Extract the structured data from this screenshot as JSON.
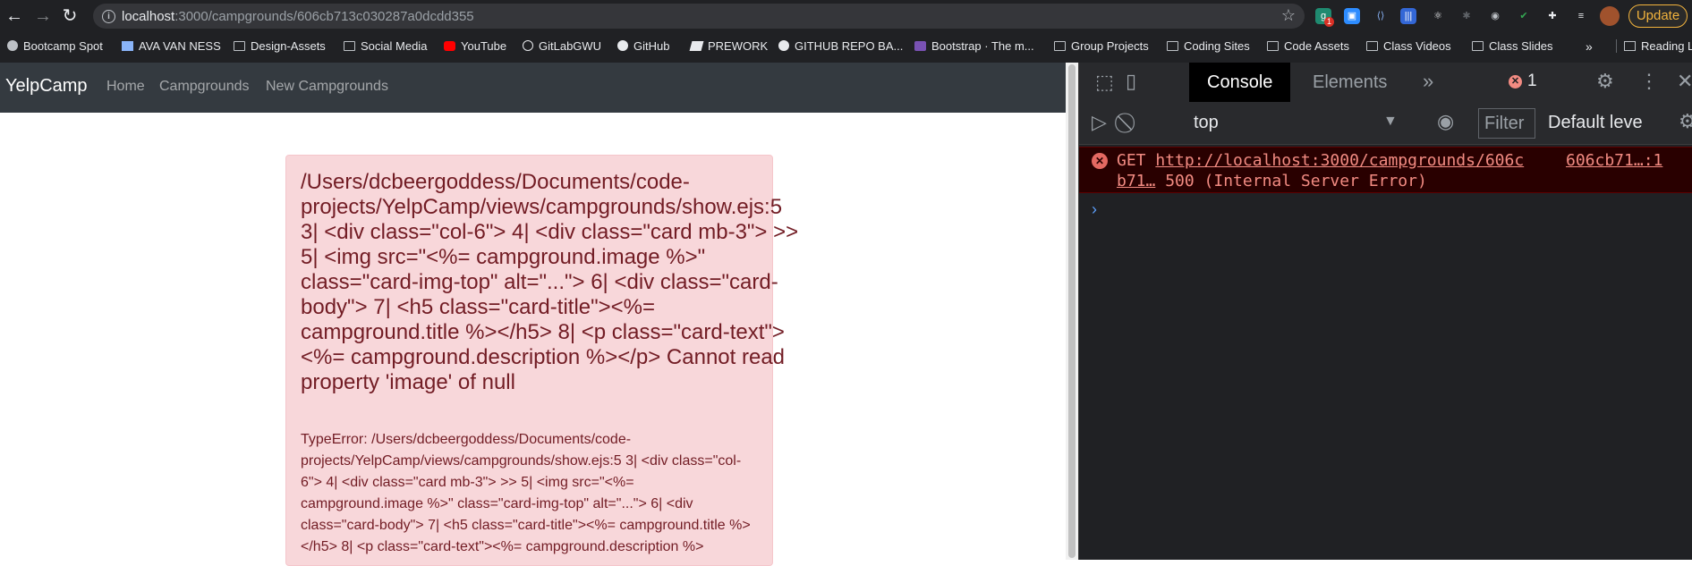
{
  "browser": {
    "url_host": "localhost",
    "url_rest": ":3000/campgrounds/606cb713c030287a0dcdd355",
    "update_label": "Update",
    "ext_badge": "1",
    "bookmarks": [
      {
        "label": "Bootcamp Spot",
        "icon": "bootcamp-icon"
      },
      {
        "label": "AVA VAN NESS",
        "icon": "page-icon"
      },
      {
        "label": "Design-Assets",
        "icon": "folder-icon"
      },
      {
        "label": "Social Media",
        "icon": "folder-icon"
      },
      {
        "label": "YouTube",
        "icon": "youtube-icon"
      },
      {
        "label": "GitLabGWU",
        "icon": "globe-icon"
      },
      {
        "label": "GitHub",
        "icon": "github-icon"
      },
      {
        "label": "PREWORK",
        "icon": "prework-icon"
      },
      {
        "label": "GITHUB REPO BA...",
        "icon": "github-icon"
      },
      {
        "label": "Bootstrap · The m...",
        "icon": "bootstrap-icon"
      },
      {
        "label": "Group Projects",
        "icon": "folder-icon"
      },
      {
        "label": "Coding Sites",
        "icon": "folder-icon"
      },
      {
        "label": "Code Assets",
        "icon": "folder-icon"
      },
      {
        "label": "Class Videos",
        "icon": "folder-icon"
      },
      {
        "label": "Class Slides",
        "icon": "folder-icon"
      }
    ],
    "overflow": "»",
    "reading_list": "Reading Li"
  },
  "page": {
    "brand": "YelpCamp",
    "nav": [
      "Home",
      "Campgrounds",
      "New Campgrounds"
    ],
    "error_heading": "/Users/dcbeergoddess/Documents/code-projects/YelpCamp/views/campgrounds/show.ejs:5 3| <div class=\"col-6\"> 4| <div class=\"card mb-3\"> >> 5| <img src=\"<%= campground.image %>\" class=\"card-img-top\" alt=\"...\"> 6| <div class=\"card-body\"> 7| <h5 class=\"card-title\"><%= campground.title %></h5> 8| <p class=\"card-text\"><%= campground.description %></p> Cannot read property 'image' of null",
    "error_detail": "TypeError: /Users/dcbeergoddess/Documents/code-projects/YelpCamp/views/campgrounds/show.ejs:5 3| <div class=\"col-6\"> 4| <div class=\"card mb-3\"> >> 5| <img src=\"<%= campground.image %>\" class=\"card-img-top\" alt=\"...\"> 6| <div class=\"card-body\"> 7| <h5 class=\"card-title\"><%= campground.title %></h5> 8| <p class=\"card-text\"><%= campground.description %>"
  },
  "devtools": {
    "tabs": [
      "Console",
      "Elements"
    ],
    "more": "»",
    "error_count": "1",
    "context": "top",
    "filter_placeholder": "Filter",
    "levels": "Default leve",
    "error": {
      "method": "GET",
      "url": "http://localhost:3000/campgrounds/606c",
      "url_cont": "b71…",
      "status": "500 (Internal Server Error)",
      "source": "606cb71…:1"
    },
    "prompt": "›"
  },
  "colors": {
    "error_bg": "#f8d7da",
    "error_text": "#721c24",
    "navbar": "#343a40",
    "update": "#f2b33d"
  }
}
